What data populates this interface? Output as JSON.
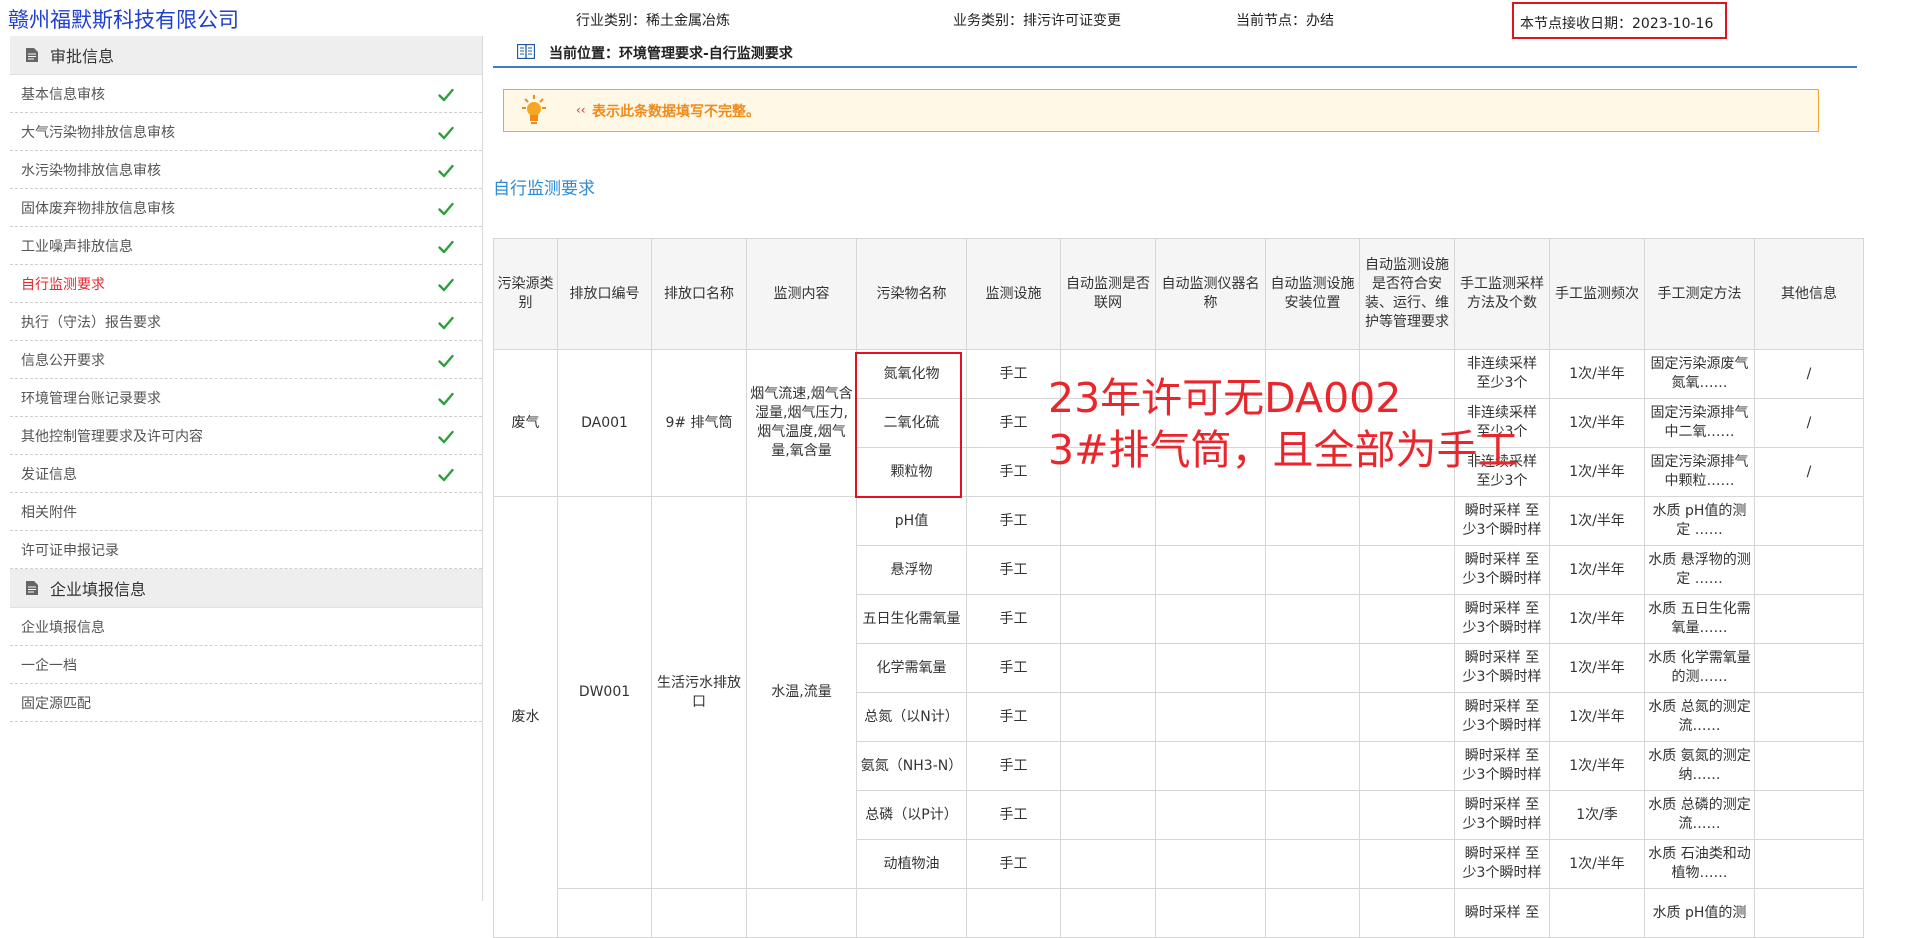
{
  "header": {
    "company": "赣州福默斯科技有限公司",
    "industry": "行业类别：稀土金属冶炼",
    "business": "业务类别：排污许可证变更",
    "node": "当前节点：办结",
    "receive_date": "本节点接收日期：2023-10-16"
  },
  "sidebar": {
    "approval_title": "审批信息",
    "approval_items": [
      {
        "label": "基本信息审核",
        "checked": true
      },
      {
        "label": "大气污染物排放信息审核",
        "checked": true
      },
      {
        "label": "水污染物排放信息审核",
        "checked": true
      },
      {
        "label": "固体废弃物排放信息审核",
        "checked": true
      },
      {
        "label": "工业噪声排放信息",
        "checked": true
      },
      {
        "label": "自行监测要求",
        "checked": true,
        "active": true
      },
      {
        "label": "执行（守法）报告要求",
        "checked": true
      },
      {
        "label": "信息公开要求",
        "checked": true
      },
      {
        "label": "环境管理台账记录要求",
        "checked": true
      },
      {
        "label": "其他控制管理要求及许可内容",
        "checked": true
      },
      {
        "label": "发证信息",
        "checked": true
      },
      {
        "label": "相关附件",
        "checked": false
      },
      {
        "label": "许可证申报记录",
        "checked": false
      }
    ],
    "enterprise_title": "企业填报信息",
    "enterprise_items": [
      {
        "label": "企业填报信息"
      },
      {
        "label": "一企一档"
      },
      {
        "label": "固定源匹配"
      }
    ]
  },
  "main": {
    "breadcrumb": "当前位置：环境管理要求-自行监测要求",
    "notice_mark": "‹‹",
    "notice": "表示此条数据填写不完整。",
    "section_title": "自行监测要求",
    "table": {
      "headers": [
        "污染源类别",
        "排放口编号",
        "排放口名称",
        "监测内容",
        "污染物名称",
        "监测设施",
        "自动监测是否联网",
        "自动监测仪器名称",
        "自动监测设施安装位置",
        "自动监测设施是否符合安装、运行、维护等管理要求",
        "手工监测采样方法及个数",
        "手工监测频次",
        "手工测定方法",
        "其他信息"
      ],
      "gas_group": {
        "category": "废气",
        "outlet_no": "DA001",
        "outlet_name": "9# 排气筒",
        "content": "烟气流速,烟气含湿量,烟气压力,烟气温度,烟气量,氧含量",
        "rows": [
          {
            "pollutant": "氮氧化物",
            "facility": "手工",
            "online": "",
            "instrument": "",
            "location": "",
            "compliant": "",
            "method": "非连续采样 至少3个",
            "freq": "1次/半年",
            "measure": "固定污染源废气 氮氧……",
            "other": "/"
          },
          {
            "pollutant": "二氧化硫",
            "facility": "手工",
            "online": "",
            "instrument": "",
            "location": "",
            "compliant": "",
            "method": "非连续采样 至少3个",
            "freq": "1次/半年",
            "measure": "固定污染源排气中二氧……",
            "other": "/"
          },
          {
            "pollutant": "颗粒物",
            "facility": "手工",
            "online": "",
            "instrument": "",
            "location": "",
            "compliant": "",
            "method": "非连续采样 至少3个",
            "freq": "1次/半年",
            "measure": "固定污染源排气中颗粒……",
            "other": "/"
          }
        ]
      },
      "water_group": {
        "category": "废水",
        "outlet_no": "DW001",
        "outlet_name": "生活污水排放口",
        "content": "水温,流量",
        "rows": [
          {
            "pollutant": "pH值",
            "facility": "手工",
            "online": "",
            "instrument": "",
            "location": "",
            "compliant": "",
            "method": "瞬时采样 至少3个瞬时样",
            "freq": "1次/半年",
            "measure": "水质 pH值的测定 ……",
            "other": ""
          },
          {
            "pollutant": "悬浮物",
            "facility": "手工",
            "online": "",
            "instrument": "",
            "location": "",
            "compliant": "",
            "method": "瞬时采样 至少3个瞬时样",
            "freq": "1次/半年",
            "measure": "水质 悬浮物的测定 ……",
            "other": ""
          },
          {
            "pollutant": "五日生化需氧量",
            "facility": "手工",
            "online": "",
            "instrument": "",
            "location": "",
            "compliant": "",
            "method": "瞬时采样 至少3个瞬时样",
            "freq": "1次/半年",
            "measure": "水质 五日生化需氧量……",
            "other": ""
          },
          {
            "pollutant": "化学需氧量",
            "facility": "手工",
            "online": "",
            "instrument": "",
            "location": "",
            "compliant": "",
            "method": "瞬时采样 至少3个瞬时样",
            "freq": "1次/半年",
            "measure": "水质 化学需氧量的测……",
            "other": ""
          },
          {
            "pollutant": "总氮（以N计）",
            "facility": "手工",
            "online": "",
            "instrument": "",
            "location": "",
            "compliant": "",
            "method": "瞬时采样 至少3个瞬时样",
            "freq": "1次/半年",
            "measure": "水质 总氮的测定 流……",
            "other": ""
          },
          {
            "pollutant": "氨氮（NH3-N）",
            "facility": "手工",
            "online": "",
            "instrument": "",
            "location": "",
            "compliant": "",
            "method": "瞬时采样 至少3个瞬时样",
            "freq": "1次/半年",
            "measure": "水质 氨氮的测定 纳……",
            "other": ""
          },
          {
            "pollutant": "总磷（以P计）",
            "facility": "手工",
            "online": "",
            "instrument": "",
            "location": "",
            "compliant": "",
            "method": "瞬时采样 至少3个瞬时样",
            "freq": "1次/季",
            "measure": "水质 总磷的测定 流……",
            "other": ""
          },
          {
            "pollutant": "动植物油",
            "facility": "手工",
            "online": "",
            "instrument": "",
            "location": "",
            "compliant": "",
            "method": "瞬时采样 至少3个瞬时样",
            "freq": "1次/半年",
            "measure": "水质 石油类和动植物……",
            "other": ""
          },
          {
            "pollutant": "",
            "facility": "",
            "online": "",
            "instrument": "",
            "location": "",
            "compliant": "",
            "method": "瞬时采样 至",
            "freq": "",
            "measure": "水质 pH值的测",
            "other": ""
          }
        ]
      }
    },
    "annotation": [
      "23年许可无DA002",
      "3#排气筒，且全部为手工"
    ]
  },
  "colors": {
    "accent": "#2e8bd6",
    "active": "#e8262c",
    "check": "#2aa23c",
    "highlight_border": "#e0141e"
  },
  "icons": {
    "section_header": "document-icon",
    "completed": "check-icon",
    "breadcrumb": "book-icon",
    "notice": "lightbulb-icon"
  }
}
